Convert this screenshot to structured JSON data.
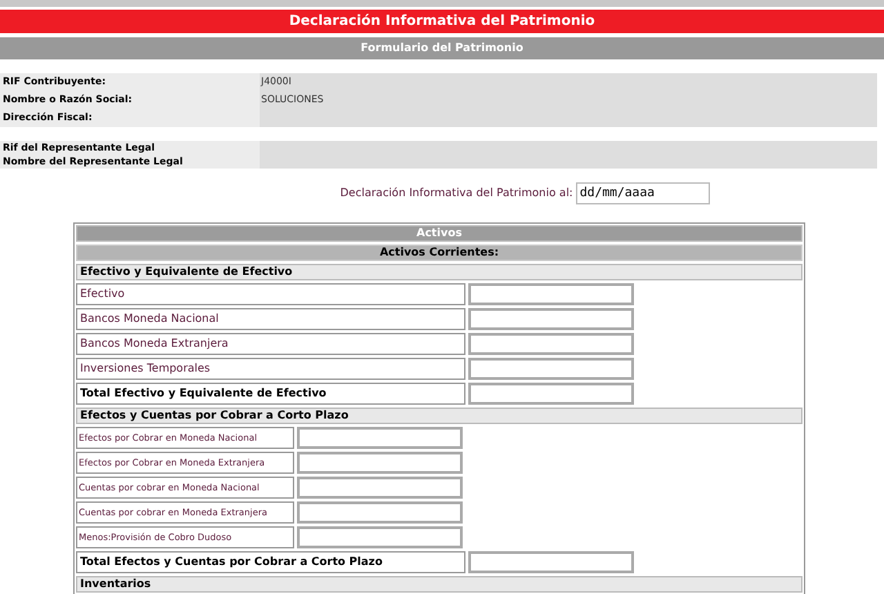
{
  "title": "Declaración Informativa del Patrimonio",
  "subtitle": "Formulario del Patrimonio",
  "taxpayer": [
    {
      "label": "RIF Contribuyente:",
      "value": "J4000I"
    },
    {
      "label": "Nombre o Razón Social:",
      "value": "SOLUCIONES"
    },
    {
      "label": "Dirección Fiscal:"
    }
  ],
  "representative": [
    {
      "label": "Rif del Representante Legal"
    },
    {
      "label": "Nombre del Representante Legal"
    }
  ],
  "date_field": {
    "label": "Declaración Informativa del Patrimonio al:",
    "placeholder": "dd/mm/aaaa"
  },
  "table": {
    "rows": [
      {
        "kind": "header",
        "label": "Activos"
      },
      {
        "kind": "subheader",
        "label": "Activos Corrientes:"
      },
      {
        "kind": "section",
        "label": "Efectivo y Equivalente de Efectivo"
      },
      {
        "kind": "item",
        "label": "Efectivo"
      },
      {
        "kind": "item",
        "label": "Bancos Moneda Nacional"
      },
      {
        "kind": "item",
        "label": "Bancos Moneda Extranjera"
      },
      {
        "kind": "item",
        "label": "Inversiones Temporales"
      },
      {
        "kind": "total",
        "label": "Total Efectivo y Equivalente de Efectivo"
      },
      {
        "kind": "section",
        "label": "Efectos y Cuentas por Cobrar a Corto Plazo"
      },
      {
        "kind": "subitem",
        "label": "Efectos por Cobrar en Moneda Nacional"
      },
      {
        "kind": "subitem",
        "label": "Efectos por Cobrar en Moneda Extranjera"
      },
      {
        "kind": "subitem",
        "label": "Cuentas por cobrar en Moneda Nacional"
      },
      {
        "kind": "subitem",
        "label": "Cuentas por cobrar en Moneda Extranjera"
      },
      {
        "kind": "subitem",
        "label": "Menos:Provisión de Cobro Dudoso"
      },
      {
        "kind": "total",
        "label": "Total Efectos y Cuentas por Cobrar a Corto Plazo"
      },
      {
        "kind": "section",
        "label": "Inventarios"
      }
    ]
  }
}
